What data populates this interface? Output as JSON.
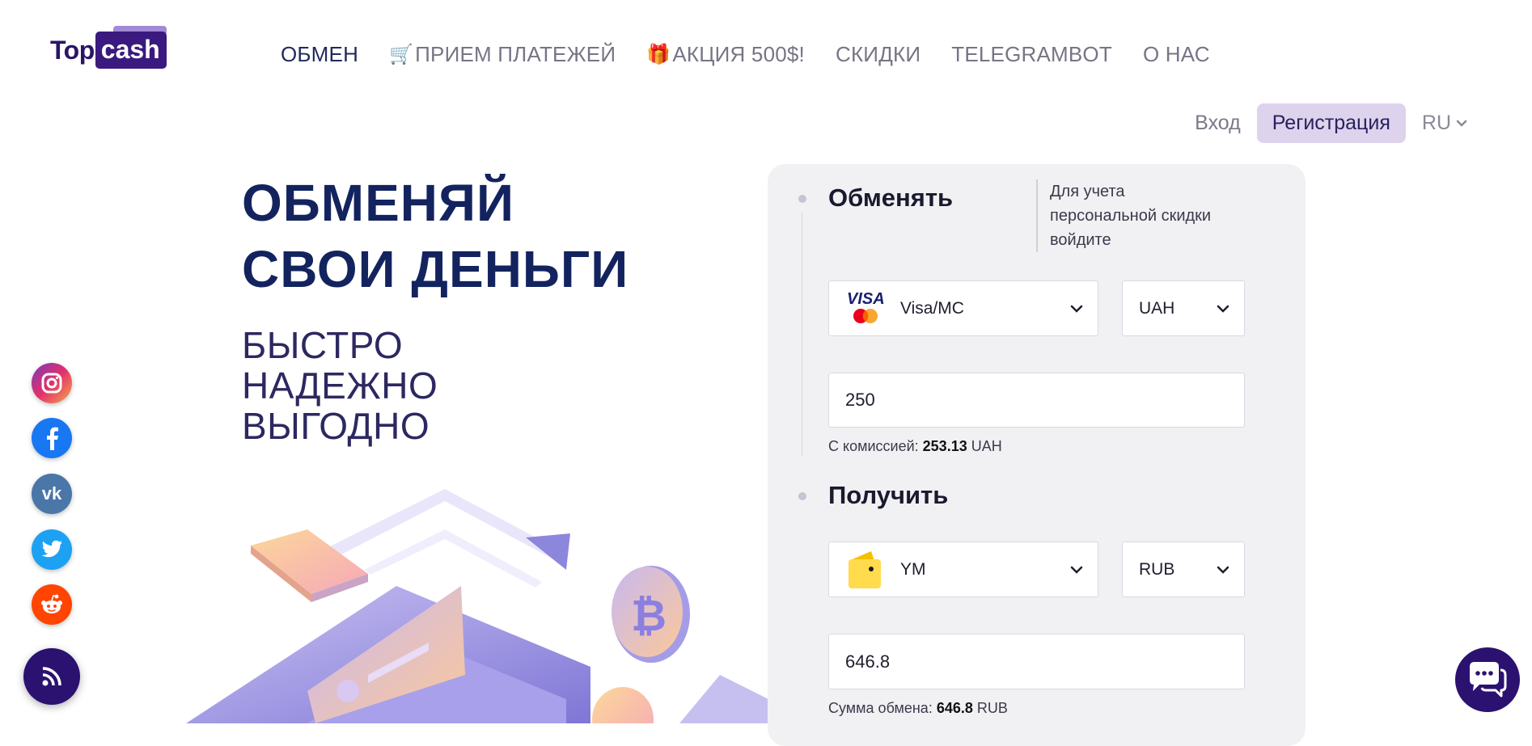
{
  "logo": {
    "part1": "Top",
    "part2": "cash"
  },
  "nav": [
    {
      "label": "ОБМЕН",
      "emoji": ""
    },
    {
      "label": "ПРИЕМ ПЛАТЕЖЕЙ",
      "emoji": "🛒"
    },
    {
      "label": "АКЦИЯ 500$!",
      "emoji": "🎁"
    },
    {
      "label": "СКИДКИ",
      "emoji": ""
    },
    {
      "label": "TELEGRAMBOT",
      "emoji": ""
    },
    {
      "label": "О НАС",
      "emoji": ""
    }
  ],
  "auth": {
    "login": "Вход",
    "register": "Регистрация",
    "lang": "RU"
  },
  "hero": {
    "title_line1": "ОБМЕНЯЙ",
    "title_line2": "СВОИ ДЕНЬГИ",
    "sub_line1": "БЫСТРО",
    "sub_line2": "НАДЕЖНО",
    "sub_line3": "ВЫГОДНО"
  },
  "social": [
    "instagram-icon",
    "facebook-icon",
    "vk-icon",
    "twitter-icon",
    "reddit-icon",
    "rss-icon"
  ],
  "exchange": {
    "give": {
      "title": "Обменять",
      "hint": "Для учета персональной скидки войдите",
      "method": "Visa/MC",
      "currency": "UAH",
      "amount": "250",
      "fee_label": "С комиссией:",
      "fee_value": "253.13",
      "fee_currency": "UAH"
    },
    "receive": {
      "title": "Получить",
      "method": "YM",
      "currency": "RUB",
      "amount": "646.8",
      "sum_label": "Сумма обмена:",
      "sum_value": "646.8",
      "sum_currency": "RUB"
    }
  },
  "colors": {
    "brand": "#2b1270",
    "title": "#13235e",
    "accent_soft": "#ddd3ec"
  }
}
